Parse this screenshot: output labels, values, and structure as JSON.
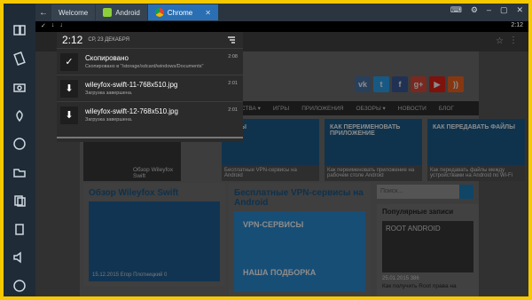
{
  "tabs": [
    {
      "label": "Welcome",
      "active": false
    },
    {
      "label": "Android",
      "active": false
    },
    {
      "label": "Chrome",
      "active": true
    }
  ],
  "status": {
    "time": "2:12"
  },
  "notification": {
    "clock": "2:12",
    "date": "СР, 23 ДЕКАБРЯ",
    "items": [
      {
        "title": "Скопировано",
        "subtitle": "Скопировано в \"/storage/sdcard/windows/Documents\"",
        "time": "2:08",
        "icon": "check-icon"
      },
      {
        "title": "wileyfox-swift-11-768x510.jpg",
        "subtitle": "Загрузка завершена.",
        "time": "2:01",
        "icon": "download-icon"
      },
      {
        "title": "wileyfox-swift-12-768x510.jpg",
        "subtitle": "Загрузка завершена.",
        "time": "2:01",
        "icon": "download-icon"
      }
    ]
  },
  "nav": [
    "РОЙСТВА ▾",
    "ИГРЫ",
    "ПРИЛОЖЕНИЯ",
    "ОБЗОРЫ ▾",
    "НОВОСТИ",
    "БЛОГ"
  ],
  "featured": [
    {
      "title": "",
      "caption": "Обзор Wileyfox Swift"
    },
    {
      "title": "ВИСЫ",
      "caption": "Бесплатные VPN-сервисы на Android"
    },
    {
      "title": "КАК ПЕРЕИМЕНОВАТЬ ПРИЛОЖЕНИЕ",
      "caption": "Как переименовать приложение на рабочем столе Android"
    },
    {
      "title": "КАК ПЕРЕДАВАТЬ ФАЙЛЫ",
      "caption": "Как передавать файлы между устройствами на Android по Wi-Fi"
    }
  ],
  "cards": [
    {
      "title": "Обзор Wileyfox Swift",
      "meta": "15.12.2015   Егор Плотницкий   0"
    },
    {
      "title": "Бесплатные VPN-сервисы на Android",
      "banner": "VPN-СЕРВИСЫ",
      "banner2": "НАША ПОДБОРКА"
    }
  ],
  "search": {
    "placeholder": "Поиск..."
  },
  "popular": {
    "title": "Популярные записи",
    "box": "ROOT ANDROID",
    "meta": "25.01.2015   386",
    "caption": "Как получить Root права на"
  }
}
